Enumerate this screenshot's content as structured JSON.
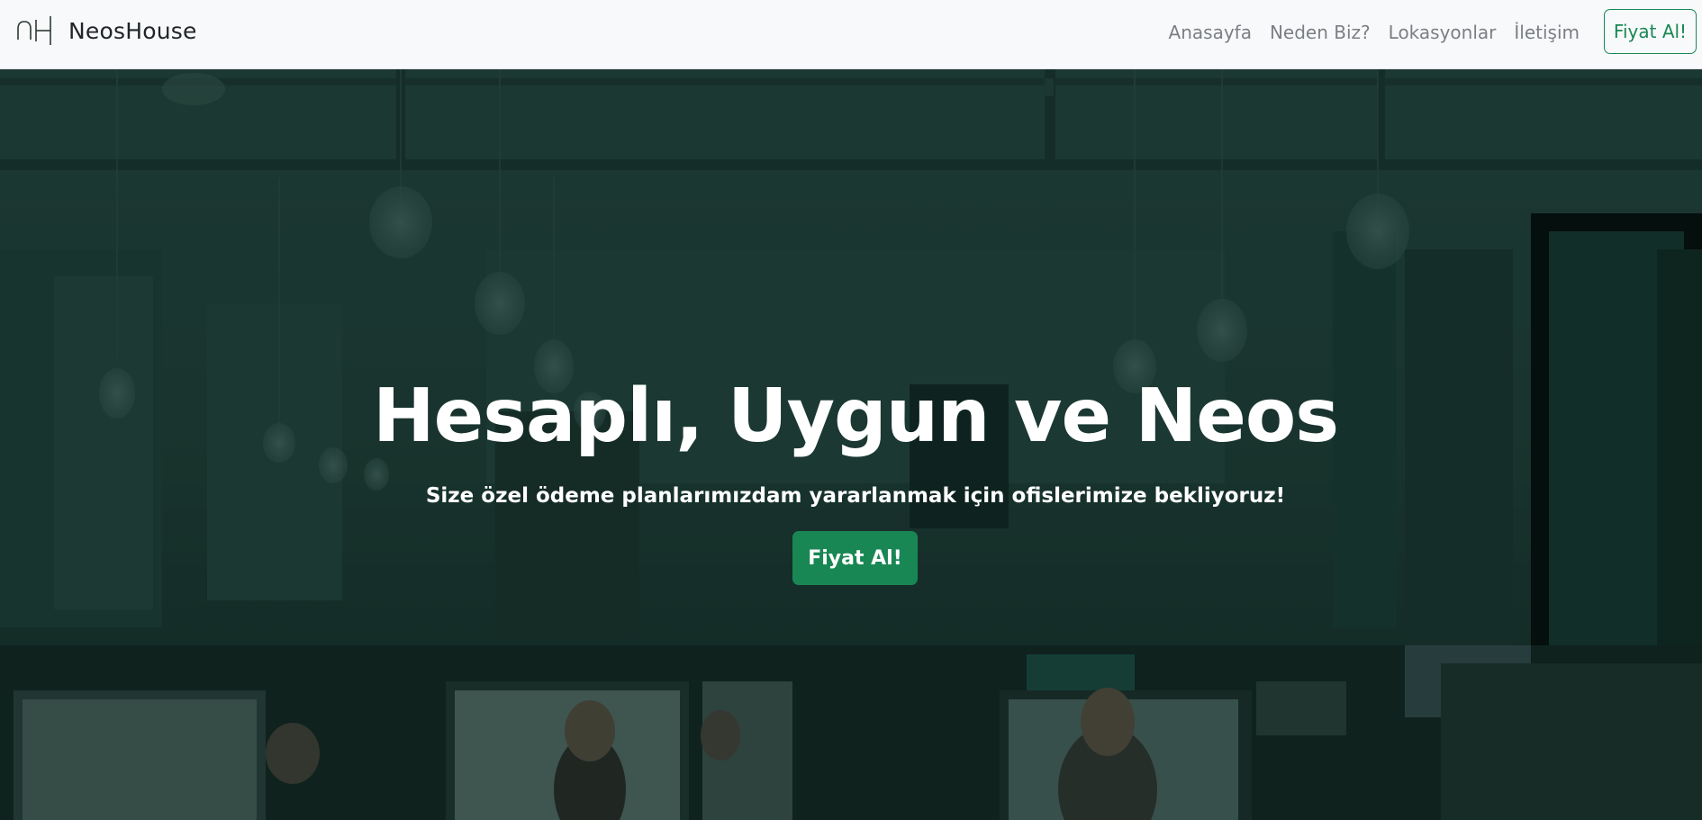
{
  "navbar": {
    "brand_name": "NeosHouse",
    "brand_logo_icon": "neoshouse-logo-icon",
    "links": [
      {
        "label": "Anasayfa"
      },
      {
        "label": "Neden Biz?"
      },
      {
        "label": "Lokasyonlar"
      },
      {
        "label": "İletişim"
      }
    ],
    "cta_label": "Fiyat Al!"
  },
  "hero": {
    "title": "Hesaplı, Uygun ve Neos",
    "subtitle": "Size özel ödeme planlarımızdam yararlanmak için ofislerimize bekliyoruz!",
    "cta_label": "Fiyat Al!",
    "background": "office-coworking-photo"
  },
  "colors": {
    "accent": "#198754",
    "navbar_bg": "#f8f9fa",
    "nav_link": "#7b7f84",
    "hero_overlay": "#0f2a24"
  }
}
